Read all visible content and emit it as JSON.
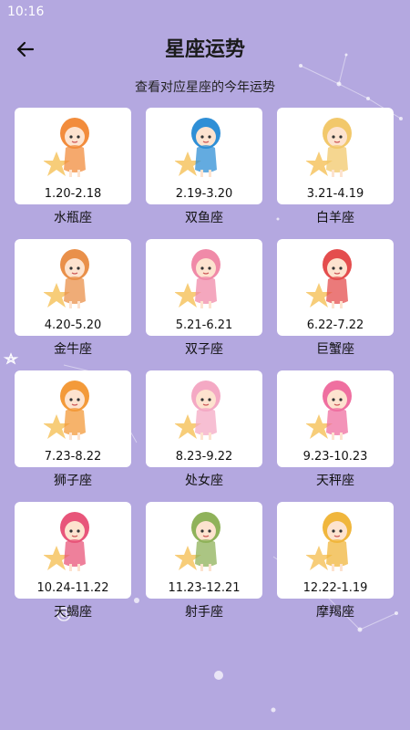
{
  "status_bar": {
    "time": "10:16"
  },
  "header": {
    "title": "星座运势",
    "subtitle": "查看对应星座的今年运势"
  },
  "signs": [
    {
      "date": "1.20-2.18",
      "name": "水瓶座",
      "accent": "#f28c3c",
      "icon": "aquarius-illustration"
    },
    {
      "date": "2.19-3.20",
      "name": "双鱼座",
      "accent": "#2f8fd6",
      "icon": "pisces-illustration"
    },
    {
      "date": "3.21-4.19",
      "name": "白羊座",
      "accent": "#f2c86b",
      "icon": "aries-illustration"
    },
    {
      "date": "4.20-5.20",
      "name": "金牛座",
      "accent": "#e9904a",
      "icon": "taurus-illustration"
    },
    {
      "date": "5.21-6.21",
      "name": "双子座",
      "accent": "#f08aa8",
      "icon": "gemini-illustration"
    },
    {
      "date": "6.22-7.22",
      "name": "巨蟹座",
      "accent": "#e44d4d",
      "icon": "cancer-illustration"
    },
    {
      "date": "7.23-8.22",
      "name": "狮子座",
      "accent": "#f39a3a",
      "icon": "leo-illustration"
    },
    {
      "date": "8.23-9.22",
      "name": "处女座",
      "accent": "#f4a9c4",
      "icon": "virgo-illustration"
    },
    {
      "date": "9.23-10.23",
      "name": "天秤座",
      "accent": "#ef6fa0",
      "icon": "libra-illustration"
    },
    {
      "date": "10.24-11.22",
      "name": "天蝎座",
      "accent": "#e8557a",
      "icon": "scorpio-illustration"
    },
    {
      "date": "11.23-12.21",
      "name": "射手座",
      "accent": "#8fb25a",
      "icon": "sagittarius-illustration"
    },
    {
      "date": "12.22-1.19",
      "name": "摩羯座",
      "accent": "#f0b63c",
      "icon": "capricorn-illustration"
    }
  ]
}
